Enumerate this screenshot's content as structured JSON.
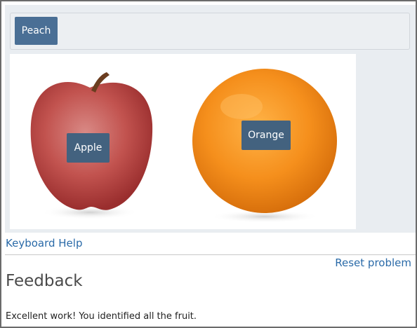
{
  "item_bank": {
    "items": [
      {
        "label": "Peach"
      }
    ]
  },
  "target": {
    "placed_items": [
      {
        "label": "Apple"
      },
      {
        "label": "Orange"
      }
    ]
  },
  "links": {
    "keyboard_help": "Keyboard Help",
    "reset_problem": "Reset problem"
  },
  "feedback": {
    "title": "Feedback",
    "message": "Excellent work! You identified all the fruit."
  },
  "colors": {
    "item_bg": "#4a6f95",
    "placed_item_bg": "#43627f",
    "link": "#2a6aa8"
  }
}
